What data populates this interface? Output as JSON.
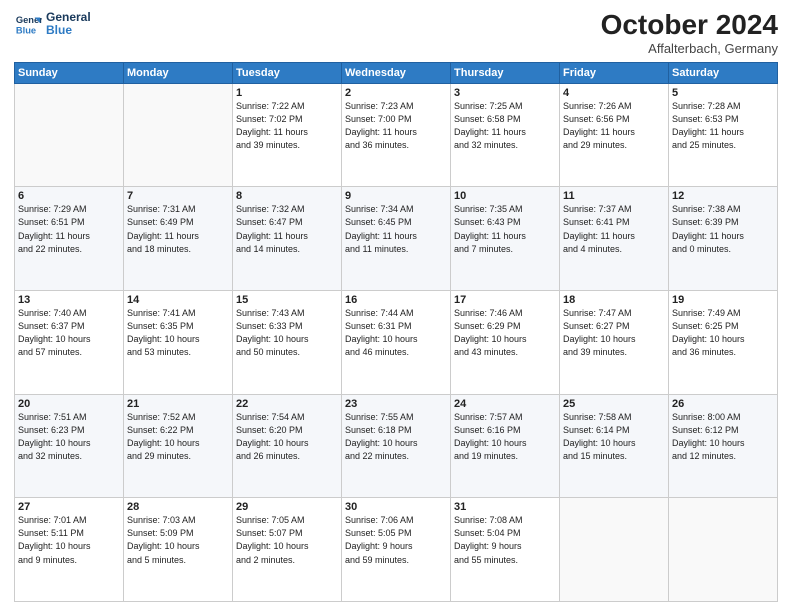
{
  "header": {
    "logo_line1": "General",
    "logo_line2": "Blue",
    "month": "October 2024",
    "location": "Affalterbach, Germany"
  },
  "weekdays": [
    "Sunday",
    "Monday",
    "Tuesday",
    "Wednesday",
    "Thursday",
    "Friday",
    "Saturday"
  ],
  "weeks": [
    [
      {
        "day": "",
        "info": ""
      },
      {
        "day": "",
        "info": ""
      },
      {
        "day": "1",
        "info": "Sunrise: 7:22 AM\nSunset: 7:02 PM\nDaylight: 11 hours\nand 39 minutes."
      },
      {
        "day": "2",
        "info": "Sunrise: 7:23 AM\nSunset: 7:00 PM\nDaylight: 11 hours\nand 36 minutes."
      },
      {
        "day": "3",
        "info": "Sunrise: 7:25 AM\nSunset: 6:58 PM\nDaylight: 11 hours\nand 32 minutes."
      },
      {
        "day": "4",
        "info": "Sunrise: 7:26 AM\nSunset: 6:56 PM\nDaylight: 11 hours\nand 29 minutes."
      },
      {
        "day": "5",
        "info": "Sunrise: 7:28 AM\nSunset: 6:53 PM\nDaylight: 11 hours\nand 25 minutes."
      }
    ],
    [
      {
        "day": "6",
        "info": "Sunrise: 7:29 AM\nSunset: 6:51 PM\nDaylight: 11 hours\nand 22 minutes."
      },
      {
        "day": "7",
        "info": "Sunrise: 7:31 AM\nSunset: 6:49 PM\nDaylight: 11 hours\nand 18 minutes."
      },
      {
        "day": "8",
        "info": "Sunrise: 7:32 AM\nSunset: 6:47 PM\nDaylight: 11 hours\nand 14 minutes."
      },
      {
        "day": "9",
        "info": "Sunrise: 7:34 AM\nSunset: 6:45 PM\nDaylight: 11 hours\nand 11 minutes."
      },
      {
        "day": "10",
        "info": "Sunrise: 7:35 AM\nSunset: 6:43 PM\nDaylight: 11 hours\nand 7 minutes."
      },
      {
        "day": "11",
        "info": "Sunrise: 7:37 AM\nSunset: 6:41 PM\nDaylight: 11 hours\nand 4 minutes."
      },
      {
        "day": "12",
        "info": "Sunrise: 7:38 AM\nSunset: 6:39 PM\nDaylight: 11 hours\nand 0 minutes."
      }
    ],
    [
      {
        "day": "13",
        "info": "Sunrise: 7:40 AM\nSunset: 6:37 PM\nDaylight: 10 hours\nand 57 minutes."
      },
      {
        "day": "14",
        "info": "Sunrise: 7:41 AM\nSunset: 6:35 PM\nDaylight: 10 hours\nand 53 minutes."
      },
      {
        "day": "15",
        "info": "Sunrise: 7:43 AM\nSunset: 6:33 PM\nDaylight: 10 hours\nand 50 minutes."
      },
      {
        "day": "16",
        "info": "Sunrise: 7:44 AM\nSunset: 6:31 PM\nDaylight: 10 hours\nand 46 minutes."
      },
      {
        "day": "17",
        "info": "Sunrise: 7:46 AM\nSunset: 6:29 PM\nDaylight: 10 hours\nand 43 minutes."
      },
      {
        "day": "18",
        "info": "Sunrise: 7:47 AM\nSunset: 6:27 PM\nDaylight: 10 hours\nand 39 minutes."
      },
      {
        "day": "19",
        "info": "Sunrise: 7:49 AM\nSunset: 6:25 PM\nDaylight: 10 hours\nand 36 minutes."
      }
    ],
    [
      {
        "day": "20",
        "info": "Sunrise: 7:51 AM\nSunset: 6:23 PM\nDaylight: 10 hours\nand 32 minutes."
      },
      {
        "day": "21",
        "info": "Sunrise: 7:52 AM\nSunset: 6:22 PM\nDaylight: 10 hours\nand 29 minutes."
      },
      {
        "day": "22",
        "info": "Sunrise: 7:54 AM\nSunset: 6:20 PM\nDaylight: 10 hours\nand 26 minutes."
      },
      {
        "day": "23",
        "info": "Sunrise: 7:55 AM\nSunset: 6:18 PM\nDaylight: 10 hours\nand 22 minutes."
      },
      {
        "day": "24",
        "info": "Sunrise: 7:57 AM\nSunset: 6:16 PM\nDaylight: 10 hours\nand 19 minutes."
      },
      {
        "day": "25",
        "info": "Sunrise: 7:58 AM\nSunset: 6:14 PM\nDaylight: 10 hours\nand 15 minutes."
      },
      {
        "day": "26",
        "info": "Sunrise: 8:00 AM\nSunset: 6:12 PM\nDaylight: 10 hours\nand 12 minutes."
      }
    ],
    [
      {
        "day": "27",
        "info": "Sunrise: 7:01 AM\nSunset: 5:11 PM\nDaylight: 10 hours\nand 9 minutes."
      },
      {
        "day": "28",
        "info": "Sunrise: 7:03 AM\nSunset: 5:09 PM\nDaylight: 10 hours\nand 5 minutes."
      },
      {
        "day": "29",
        "info": "Sunrise: 7:05 AM\nSunset: 5:07 PM\nDaylight: 10 hours\nand 2 minutes."
      },
      {
        "day": "30",
        "info": "Sunrise: 7:06 AM\nSunset: 5:05 PM\nDaylight: 9 hours\nand 59 minutes."
      },
      {
        "day": "31",
        "info": "Sunrise: 7:08 AM\nSunset: 5:04 PM\nDaylight: 9 hours\nand 55 minutes."
      },
      {
        "day": "",
        "info": ""
      },
      {
        "day": "",
        "info": ""
      }
    ]
  ]
}
